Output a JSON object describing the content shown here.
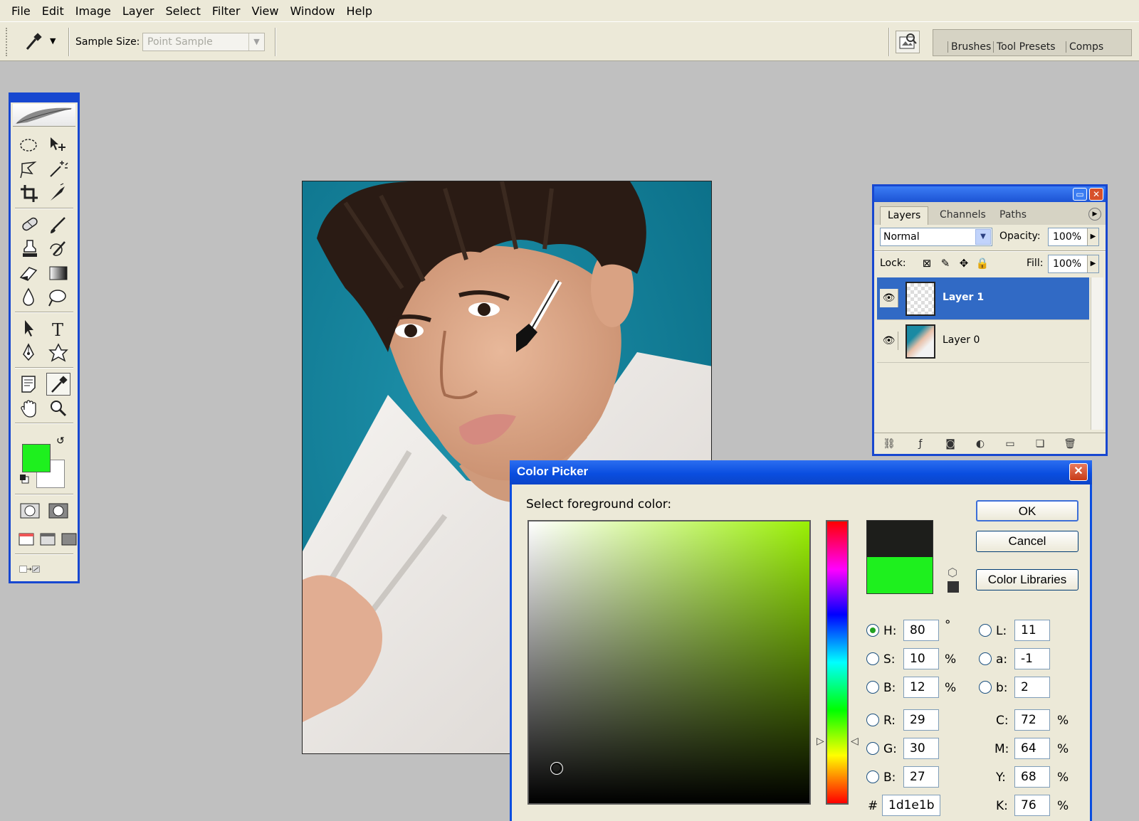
{
  "menu": [
    "File",
    "Edit",
    "Image",
    "Layer",
    "Select",
    "Filter",
    "View",
    "Window",
    "Help"
  ],
  "options_bar": {
    "sample_size_label": "Sample Size:",
    "sample_size_value": "Point Sample"
  },
  "palette_well": {
    "tabs": [
      "Brushes",
      "Tool Presets",
      "Comps"
    ]
  },
  "toolbox": {
    "foreground_color": "#1ef01e",
    "background_color": "#ffffff",
    "tools": [
      "elliptical-marquee",
      "move",
      "lasso",
      "magic-wand",
      "crop",
      "slice",
      "healing-brush",
      "brush",
      "clone-stamp",
      "history-brush",
      "eraser",
      "gradient",
      "blur",
      "dodge",
      "path-selection",
      "type",
      "pen",
      "custom-shape",
      "notes",
      "eyedropper",
      "hand",
      "zoom"
    ],
    "active_tool": "eyedropper"
  },
  "layers_panel": {
    "tabs": [
      "Layers",
      "Channels",
      "Paths"
    ],
    "blend_mode": "Normal",
    "opacity_label": "Opacity:",
    "opacity": "100%",
    "lock_label": "Lock:",
    "fill_label": "Fill:",
    "fill": "100%",
    "layers": [
      {
        "name": "Layer 1",
        "selected": true
      },
      {
        "name": "Layer 0",
        "selected": false
      }
    ]
  },
  "color_picker": {
    "title": "Color Picker",
    "subtitle": "Select foreground color:",
    "ok_label": "OK",
    "cancel_label": "Cancel",
    "libraries_label": "Color Libraries",
    "new_color": "#1d1e1b",
    "current_color": "#1ef01e",
    "fields": {
      "H": "80",
      "S": "10",
      "B": "12",
      "R": "29",
      "G": "30",
      "Bl": "27",
      "L": "11",
      "a": "-1",
      "b": "2",
      "C": "72",
      "M": "64",
      "Y": "68",
      "K": "76"
    },
    "labels": {
      "H": "H:",
      "S": "S:",
      "B": "B:",
      "R": "R:",
      "G": "G:",
      "Bl": "B:",
      "L": "L:",
      "a": "a:",
      "b": "b:",
      "C": "C:",
      "M": "M:",
      "Y": "Y:",
      "K": "K:"
    },
    "units": {
      "deg": "°",
      "pct": "%"
    },
    "hex_label": "#",
    "hex": "1d1e1b",
    "selected_mode": "H"
  }
}
